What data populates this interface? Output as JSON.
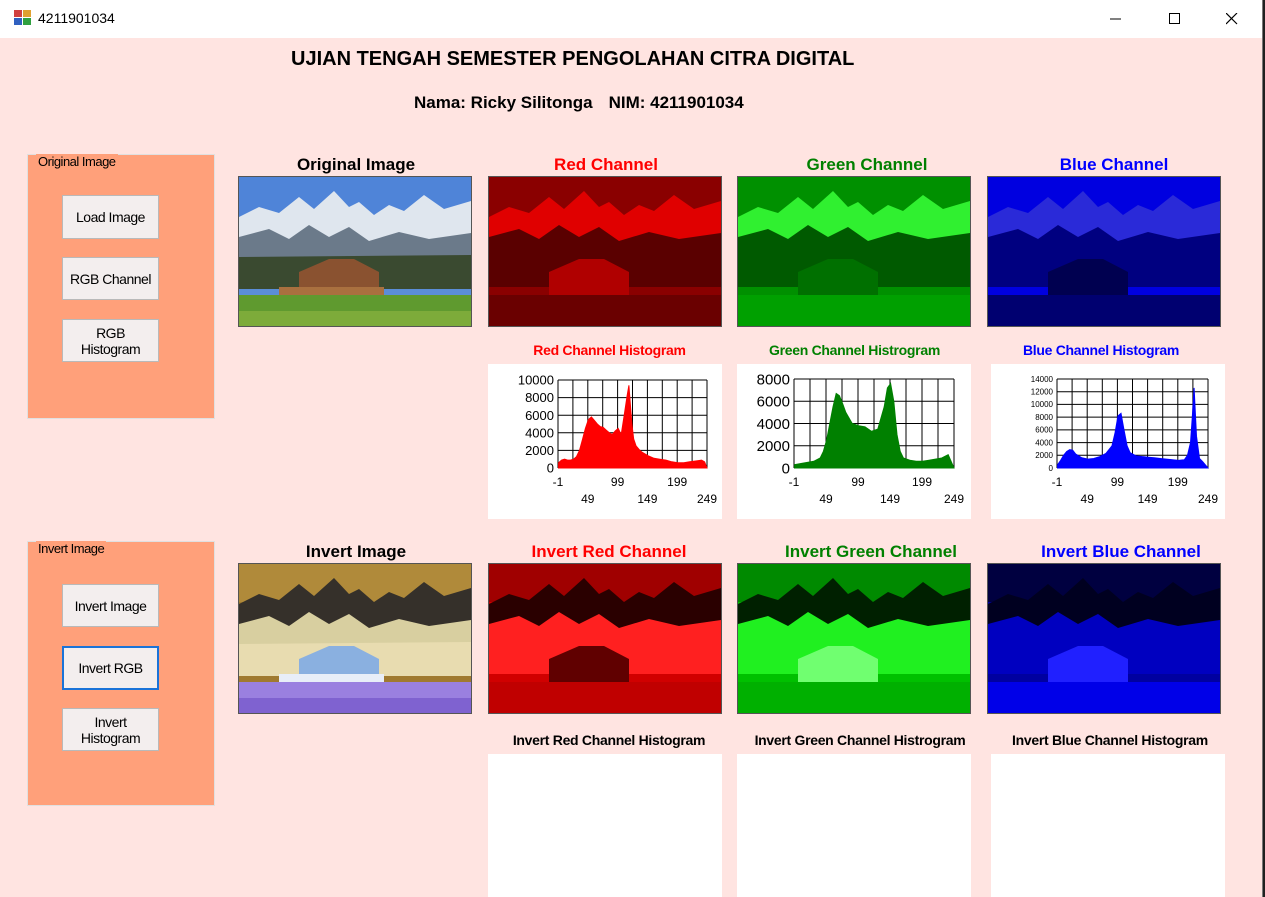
{
  "window": {
    "title": "4211901034"
  },
  "header": {
    "title": "UJIAN TENGAH SEMESTER PENGOLAHAN CITRA DIGITAL",
    "student_name": "Nama: Ricky Silitonga",
    "student_nim": "NIM: 4211901034"
  },
  "groups": {
    "original": {
      "label": "Original Image",
      "buttons": [
        "Load Image",
        "RGB Channel",
        "RGB\nHistogram"
      ]
    },
    "invert": {
      "label": "Invert Image",
      "buttons": [
        "Invert Image",
        "Invert RGB",
        "Invert\nHistogram"
      ]
    }
  },
  "captions": {
    "original": "Original Image",
    "red": "Red Channel",
    "green": "Green Channel",
    "blue": "Blue Channel",
    "red_hist": "Red Channel Histogram",
    "green_hist": "Green Channel Histrogram",
    "blue_hist": "Blue Channel Histogram",
    "invert": "Invert Image",
    "inv_red": "Invert Red Channel",
    "inv_green": "Invert Green Channel",
    "inv_blue": "Invert Blue Channel",
    "inv_red_hist": "Invert Red Channel Histogram",
    "inv_green_hist": "Invert Green Channel Histrogram",
    "inv_blue_hist": "Invert Blue Channel Histogram"
  },
  "colors": {
    "red": "#ff0000",
    "green": "#008000",
    "blue": "#0000ff",
    "form_bg": "#ffe4e1",
    "group_bg": "#ffa07a"
  },
  "chart_data": [
    {
      "type": "area",
      "name": "red-histogram",
      "color": "#ff0000",
      "x_ticks_top": [
        "-1",
        "99",
        "199"
      ],
      "x_ticks_bottom": [
        "49",
        "149",
        "249"
      ],
      "y_ticks": [
        "10000",
        "8000",
        "6000",
        "4000",
        "2000",
        "0"
      ],
      "ylim": [
        0,
        10000
      ],
      "xlim": [
        -1,
        249
      ],
      "x": [
        0,
        5,
        10,
        15,
        20,
        25,
        30,
        35,
        40,
        45,
        50,
        55,
        60,
        65,
        70,
        75,
        80,
        85,
        90,
        95,
        100,
        105,
        110,
        115,
        118,
        120,
        123,
        126,
        130,
        135,
        140,
        150,
        160,
        170,
        180,
        190,
        200,
        210,
        220,
        230,
        240,
        245,
        249
      ],
      "y": [
        600,
        900,
        1000,
        900,
        900,
        1000,
        1300,
        2000,
        3200,
        4500,
        5500,
        5800,
        5400,
        5000,
        4700,
        4600,
        4300,
        4000,
        3800,
        4200,
        4500,
        3800,
        6000,
        8200,
        9400,
        7600,
        5000,
        3300,
        2500,
        2100,
        1800,
        1400,
        1100,
        1000,
        900,
        700,
        600,
        600,
        700,
        800,
        900,
        700,
        0
      ]
    },
    {
      "type": "area",
      "name": "green-histogram",
      "color": "#008000",
      "x_ticks_top": [
        "-1",
        "99",
        "199"
      ],
      "x_ticks_bottom": [
        "49",
        "149",
        "249"
      ],
      "y_ticks": [
        "8000",
        "6000",
        "4000",
        "2000",
        "0"
      ],
      "ylim": [
        0,
        8000
      ],
      "xlim": [
        -1,
        249
      ],
      "x": [
        0,
        10,
        20,
        30,
        40,
        45,
        50,
        55,
        60,
        65,
        70,
        75,
        80,
        90,
        100,
        110,
        120,
        130,
        140,
        145,
        150,
        155,
        160,
        165,
        170,
        180,
        190,
        200,
        210,
        220,
        230,
        240,
        249
      ],
      "y": [
        300,
        400,
        500,
        600,
        900,
        1500,
        2500,
        4000,
        5500,
        6700,
        6500,
        5800,
        5000,
        4000,
        3800,
        3700,
        3300,
        3500,
        5500,
        7200,
        7600,
        6000,
        3000,
        1500,
        900,
        700,
        600,
        600,
        700,
        800,
        900,
        1200,
        0
      ]
    },
    {
      "type": "area",
      "name": "blue-histogram",
      "color": "#0000ff",
      "x_ticks_top": [
        "-1",
        "99",
        "199"
      ],
      "x_ticks_bottom": [
        "49",
        "149",
        "249"
      ],
      "y_ticks": [
        "14000",
        "12000",
        "10000",
        "8000",
        "6000",
        "4000",
        "2000",
        "0"
      ],
      "ylim": [
        0,
        14000
      ],
      "xlim": [
        -1,
        249
      ],
      "x": [
        0,
        5,
        10,
        15,
        20,
        25,
        30,
        40,
        50,
        60,
        70,
        80,
        90,
        95,
        100,
        105,
        110,
        115,
        120,
        130,
        140,
        150,
        160,
        170,
        180,
        190,
        200,
        210,
        215,
        220,
        223,
        226,
        230,
        235,
        240,
        249
      ],
      "y": [
        500,
        1200,
        2000,
        2600,
        2900,
        2800,
        2200,
        1600,
        1400,
        1500,
        1800,
        2300,
        3500,
        5500,
        8200,
        8600,
        6000,
        3500,
        2400,
        1900,
        1800,
        1700,
        1600,
        1500,
        1400,
        1300,
        1200,
        1300,
        2000,
        4000,
        8000,
        12600,
        5000,
        1500,
        1000,
        0
      ]
    }
  ]
}
